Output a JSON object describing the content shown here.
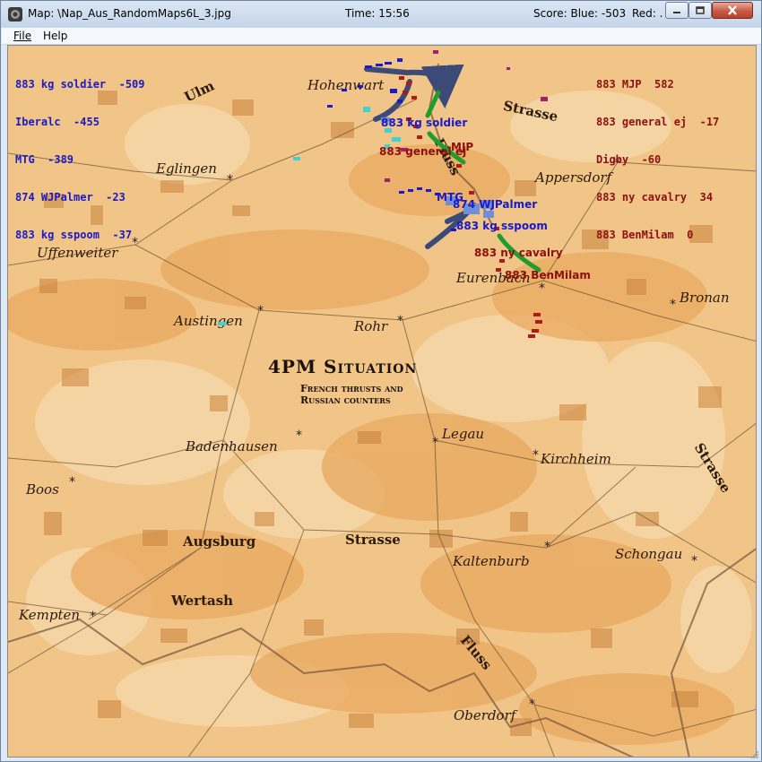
{
  "window": {
    "title": "Map: \\Nap_Aus_RandomMaps6L_3.jpg",
    "time": "Time: 15:56",
    "score": "Score: Blue: -503",
    "red": "Red: ."
  },
  "menu": {
    "file": "File",
    "help": "Help"
  },
  "map": {
    "title": "4PM Situation",
    "subtitle_line1": "French thrusts and",
    "subtitle_line2": "Russian counters",
    "towns": {
      "ulm": "Ulm",
      "hohenwart": "Hohenwart",
      "eglingen": "Eglingen",
      "uffenweiter": "Uffenweiter",
      "appersdorf": "Appersdorf",
      "eurenbach": "Eurenbach",
      "bronan": "Bronan",
      "austingen": "Austingen",
      "rohr": "Rohr",
      "legau": "Legau",
      "badenhausen": "Badenhausen",
      "kirchheim": "Kirchheim",
      "boos": "Boos",
      "augsburg": "Augsburg",
      "strasse_mid": "Strasse",
      "kaltenburb": "Kaltenburb",
      "schongau": "Schongau",
      "wertash": "Wertash",
      "kempten": "Kempten",
      "oberdorf": "Oberdorf",
      "strasse_top": "Strasse",
      "strasse_right": "Strasse",
      "fluss_top": "Fluss",
      "fluss_bottom": "Fluss"
    }
  },
  "blue_scores": [
    "883 kg soldier  -509",
    "Iberalc  -455",
    "MTG  -389",
    "874 WJPalmer  -23",
    "883 kg sspoom  -37"
  ],
  "red_scores": [
    "883 MJP  582",
    "883 general ej  -17",
    "Digby  -60",
    "883 ny cavalry  34",
    "883 BenMilam  0"
  ],
  "unit_labels": {
    "kg_soldier": "883 kg soldier",
    "general_ej": "883 general ej",
    "mjp": "MJP",
    "mtg": "MTG",
    "wj_palmer": "874 WJPalmer",
    "kg_sspoom": "883 kg sspoom",
    "ny_cavalry": "883 ny cavalry",
    "ben_milam": "883 BenMilam"
  },
  "colors": {
    "blue_side": "#1a1ac8",
    "red_side": "#8b1010",
    "map_base": "#f1c488",
    "blue_arrow": "#3c4a78",
    "red_arrow": "#1e9e2e"
  }
}
